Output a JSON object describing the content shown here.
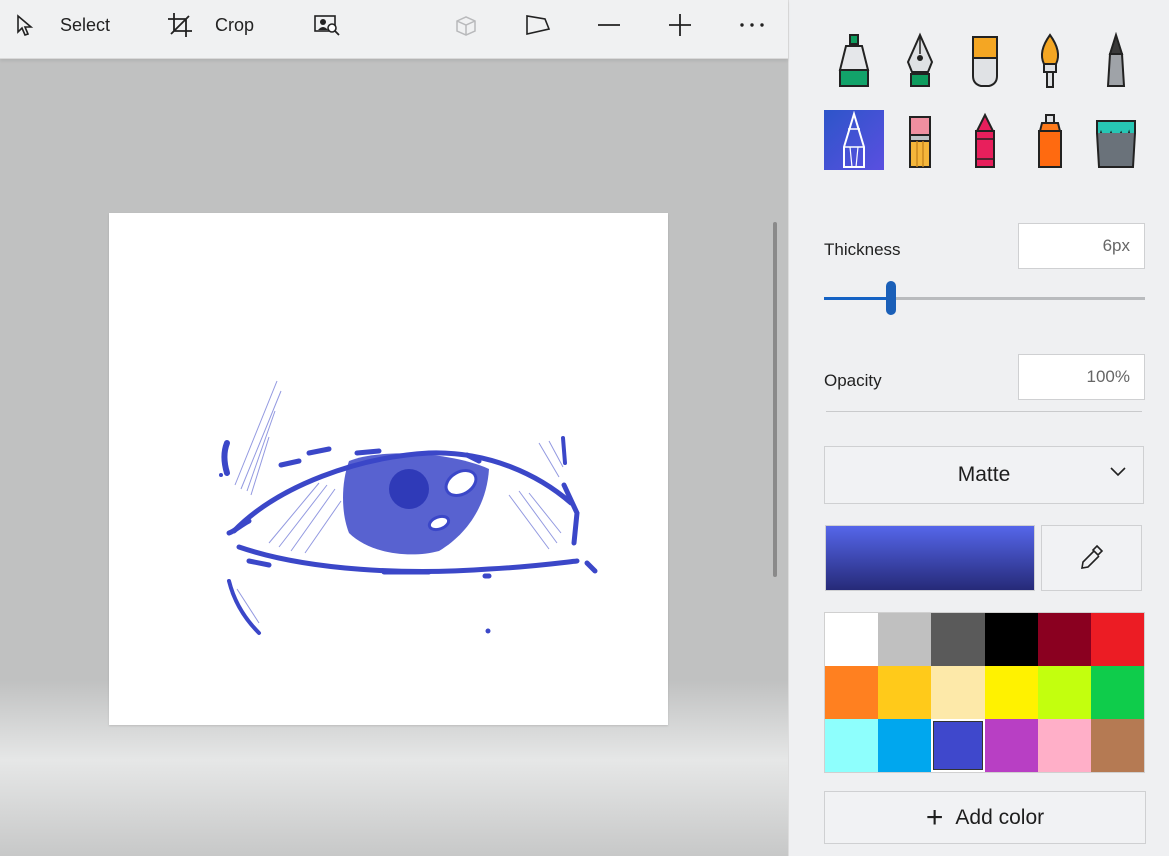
{
  "toolbar": {
    "select_label": "Select",
    "crop_label": "Crop",
    "icons": [
      "select-cursor-icon",
      "crop-icon",
      "magic-select-icon",
      "view-3d-icon",
      "flip-icon",
      "zoom-out-icon",
      "zoom-in-icon",
      "more-options-icon"
    ]
  },
  "canvas": {
    "stroke_color": "#3b47c8",
    "drawing": "hand-drawn eye sketch"
  },
  "brushes": [
    {
      "name": "marker",
      "icon": "marker-icon"
    },
    {
      "name": "calligraphy-pen",
      "icon": "calligraphy-pen-icon"
    },
    {
      "name": "oil-brush",
      "icon": "oil-brush-icon"
    },
    {
      "name": "watercolor",
      "icon": "watercolor-brush-icon"
    },
    {
      "name": "pixel-pen",
      "icon": "pixel-pen-icon"
    },
    {
      "name": "pencil",
      "icon": "pencil-icon",
      "selected": true
    },
    {
      "name": "eraser",
      "icon": "eraser-icon"
    },
    {
      "name": "crayon",
      "icon": "crayon-icon"
    },
    {
      "name": "spray-can",
      "icon": "spray-can-icon"
    },
    {
      "name": "fill",
      "icon": "fill-bucket-icon"
    }
  ],
  "thickness": {
    "label": "Thickness",
    "value": "6px",
    "slider_fraction": 0.21
  },
  "opacity": {
    "label": "Opacity",
    "value": "100%"
  },
  "finish": {
    "selected": "Matte"
  },
  "current_color": {
    "top": "#5566ea",
    "bottom": "#262a78"
  },
  "palette": [
    "#ffffff",
    "#c0c0c0",
    "#5a5a5a",
    "#000000",
    "#8a0020",
    "#ec1c24",
    "#ff8020",
    "#ffca1a",
    "#fde9a9",
    "#fff200",
    "#c3ff0e",
    "#0fcc4b",
    "#8efffd",
    "#00a7ee",
    "#3f48cc",
    "#b83fc4",
    "#ffafc8",
    "#b57a53"
  ],
  "palette_selected_index": 14,
  "add_color_label": "Add color"
}
